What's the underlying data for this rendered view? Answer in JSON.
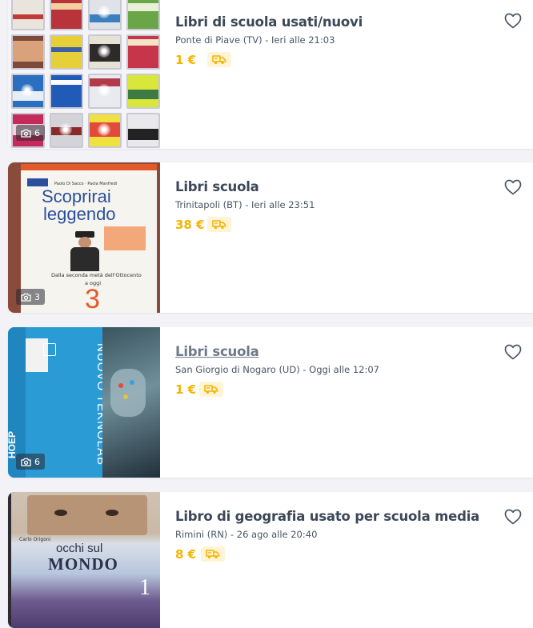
{
  "listings": [
    {
      "title": "Libri di scuola usati/nuovi",
      "location_time": "Ponte di Piave (TV) - Ieri alle 21:03",
      "price": "1 €",
      "photo_count": "6",
      "visited": false
    },
    {
      "title": "Libri scuola",
      "location_time": "Trinitapoli (BT) - Ieri alle 23:51",
      "price": "38 €",
      "photo_count": "3",
      "visited": false,
      "cover": {
        "top_line": "Paolo Di Sacco · Paola Manfredi",
        "title_line1": "Scoprirai",
        "title_line2": "leggendo",
        "subtitle": "Dalla seconda metà dell'Ottocento",
        "subtitle2": "a oggi",
        "volume": "3"
      }
    },
    {
      "title": "Libri scuola",
      "location_time": "San Giorgio di Nogaro (UD) - Oggi alle 12:07",
      "price": "1 €",
      "photo_count": "6",
      "visited": true,
      "cover": {
        "title": "NUOVO TEKNOLAB",
        "spine": "HOEP"
      }
    },
    {
      "title": "Libro di geografia usato per scuola media",
      "location_time": "Rimini (RN) - 26 ago alle 20:40",
      "price": "8 €",
      "visited": false,
      "cover": {
        "author": "Carlo Origoni",
        "title_line1": "occhi sul",
        "title_line2": "MONDO",
        "volume": "1"
      }
    }
  ],
  "colors": {
    "price": "#f4b400",
    "title": "#3c4858",
    "background": "#f2f2f7",
    "shipping_badge": "#fff4d6"
  },
  "icons": {
    "favorite": "heart-outline-icon",
    "shipping": "delivery-truck-icon",
    "photos": "camera-icon"
  }
}
